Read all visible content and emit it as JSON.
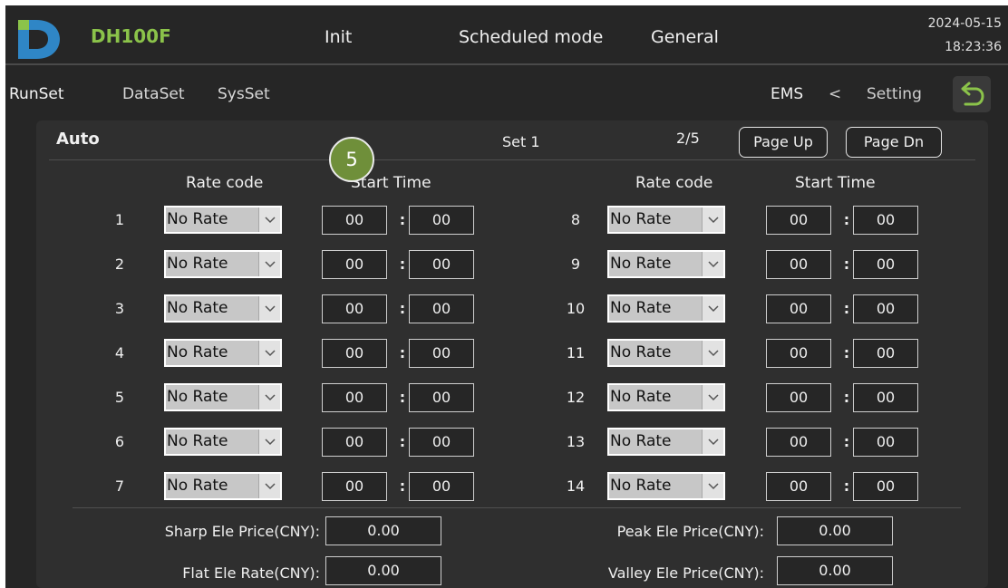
{
  "header": {
    "device_name": "DH100F",
    "run_state": "Init",
    "operation_mode": "Scheduled mode",
    "work_mode": "General",
    "date": "2024-05-15",
    "time": "18:23:36",
    "logo_icon": "d-letter-logo",
    "logo_color": "#2f86c6",
    "brand_color": "#8bc34a"
  },
  "tabs": [
    "RunSet",
    "DataSet",
    "SysSet"
  ],
  "breadcrumb": {
    "current": "EMS",
    "separator": "<",
    "parent": "Setting"
  },
  "back_icon": "return-arrow-icon",
  "back_icon_color": "#8bc34a",
  "panel": {
    "title": "Auto",
    "set_label": "Set 1",
    "page_indicator": "2/5",
    "page_up": "Page Up",
    "page_dn": "Page Dn"
  },
  "step_badge": "5",
  "step_badge_color": "#6f8f3a",
  "columns": {
    "rate_code": "Rate code",
    "start_time": "Start Time"
  },
  "time_separator": ":",
  "dropdown_arrow": "chevron-down-icon",
  "rows_left": [
    {
      "index": "1",
      "rate": "No Rate",
      "hour": "00",
      "minute": "00"
    },
    {
      "index": "2",
      "rate": "No Rate",
      "hour": "00",
      "minute": "00"
    },
    {
      "index": "3",
      "rate": "No Rate",
      "hour": "00",
      "minute": "00"
    },
    {
      "index": "4",
      "rate": "No Rate",
      "hour": "00",
      "minute": "00"
    },
    {
      "index": "5",
      "rate": "No Rate",
      "hour": "00",
      "minute": "00"
    },
    {
      "index": "6",
      "rate": "No Rate",
      "hour": "00",
      "minute": "00"
    },
    {
      "index": "7",
      "rate": "No Rate",
      "hour": "00",
      "minute": "00"
    }
  ],
  "rows_right": [
    {
      "index": "8",
      "rate": "No Rate",
      "hour": "00",
      "minute": "00"
    },
    {
      "index": "9",
      "rate": "No Rate",
      "hour": "00",
      "minute": "00"
    },
    {
      "index": "10",
      "rate": "No Rate",
      "hour": "00",
      "minute": "00"
    },
    {
      "index": "11",
      "rate": "No Rate",
      "hour": "00",
      "minute": "00"
    },
    {
      "index": "12",
      "rate": "No Rate",
      "hour": "00",
      "minute": "00"
    },
    {
      "index": "13",
      "rate": "No Rate",
      "hour": "00",
      "minute": "00"
    },
    {
      "index": "14",
      "rate": "No Rate",
      "hour": "00",
      "minute": "00"
    }
  ],
  "prices": {
    "sharp_label": "Sharp Ele Price(CNY):",
    "sharp_value": "0.00",
    "peak_label": "Peak Ele Price(CNY):",
    "peak_value": "0.00",
    "flat_label": "Flat Ele Rate(CNY):",
    "flat_value": "0.00",
    "valley_label": "Valley Ele Price(CNY):",
    "valley_value": "0.00"
  }
}
